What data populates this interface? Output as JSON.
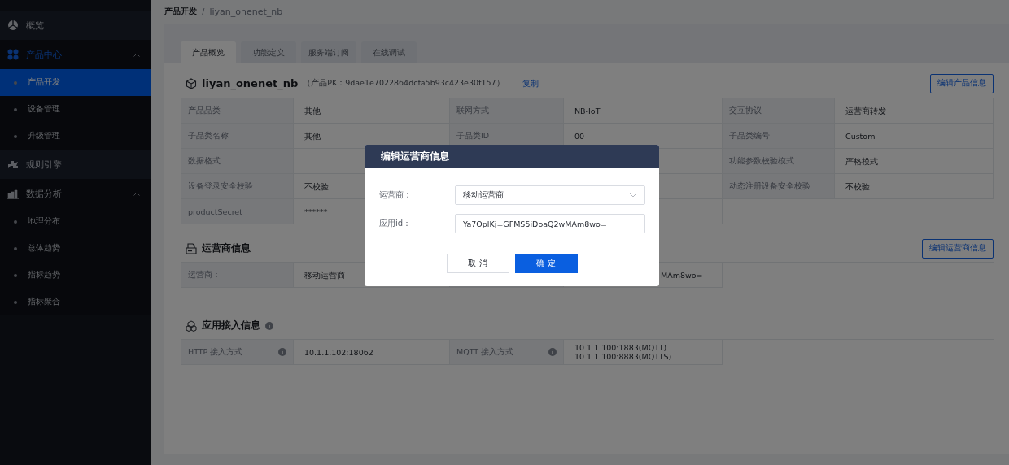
{
  "sidebar": {
    "items": [
      {
        "label": "概览",
        "selected": false
      },
      {
        "label": "产品中心",
        "selected": false,
        "expanded": true,
        "children": [
          {
            "label": "产品开发",
            "selected": true
          },
          {
            "label": "设备管理",
            "selected": false
          },
          {
            "label": "升级管理",
            "selected": false
          }
        ]
      },
      {
        "label": "规则引擎",
        "selected": false
      },
      {
        "label": "数据分析",
        "selected": false,
        "expanded": true,
        "children": [
          {
            "label": "地理分布",
            "selected": false
          },
          {
            "label": "总体趋势",
            "selected": false
          },
          {
            "label": "指标趋势",
            "selected": false
          },
          {
            "label": "指标聚合",
            "selected": false
          }
        ]
      }
    ]
  },
  "breadcrumb": {
    "items": [
      "产品开发",
      "liyan_onenet_nb"
    ],
    "separator": "/"
  },
  "tabs": [
    {
      "label": "产品概览",
      "selected": true
    },
    {
      "label": "功能定义",
      "selected": false
    },
    {
      "label": "服务端订阅",
      "selected": false
    },
    {
      "label": "在线调试",
      "selected": false
    }
  ],
  "product": {
    "name": "liyan_onenet_nb",
    "pk": "（产品PK：9dae1e7022864dcfa5b93c423e30f157）",
    "copy_link": "复制",
    "edit_button": "编辑产品信息",
    "rows": [
      [
        {
          "label": "产品品类",
          "value": "其他"
        },
        {
          "label": "联网方式",
          "value": "NB-IoT"
        },
        {
          "label": "交互协议",
          "value": "运营商转发"
        }
      ],
      [
        {
          "label": "子品类名称",
          "value": "其他"
        },
        {
          "label": "子品类ID",
          "value": "00"
        },
        {
          "label": "子品类编号",
          "value": "Custom"
        }
      ],
      [
        {
          "label": "数据格式"
        },
        {},
        {
          "label": "功能参数校验模式",
          "value": "严格模式"
        }
      ],
      [
        {
          "label": "设备登录安全校验",
          "value": "不校验"
        },
        {},
        {
          "label": "动态注册设备安全校验",
          "value": "不校验"
        }
      ],
      [
        {
          "label": "productSecret",
          "value": "******"
        },
        {}
      ]
    ]
  },
  "operator": {
    "title": "运营商信息",
    "edit_button": "编辑运营商信息",
    "rows": [
      [
        {
          "label": "运营商：",
          "value": "移动运营商"
        },
        {
          "value": "MAm8wo="
        }
      ]
    ]
  },
  "access": {
    "title": "应用接入信息",
    "info": true,
    "rows": [
      [
        {
          "label": "HTTP 接入方式",
          "info": true,
          "value": [
            "10.1.1.102:18062"
          ]
        },
        {
          "label": "MQTT 接入方式",
          "info": true,
          "value": [
            "10.1.1.100:1883(MQTT)",
            "10.1.1.100:8883(MQTTS)"
          ]
        }
      ]
    ]
  },
  "dialog": {
    "title": "编辑运营商信息",
    "fields": [
      {
        "kind": "select",
        "label": "运营商：",
        "value": "移动运营商"
      },
      {
        "kind": "input",
        "label": "应用id：",
        "value": "Ya7OplKj=GFMS5iDoaQ2wMAm8wo="
      }
    ],
    "buttons": [
      {
        "kind": "default",
        "label": "取 消"
      },
      {
        "kind": "primary",
        "label": "确 定"
      }
    ]
  }
}
